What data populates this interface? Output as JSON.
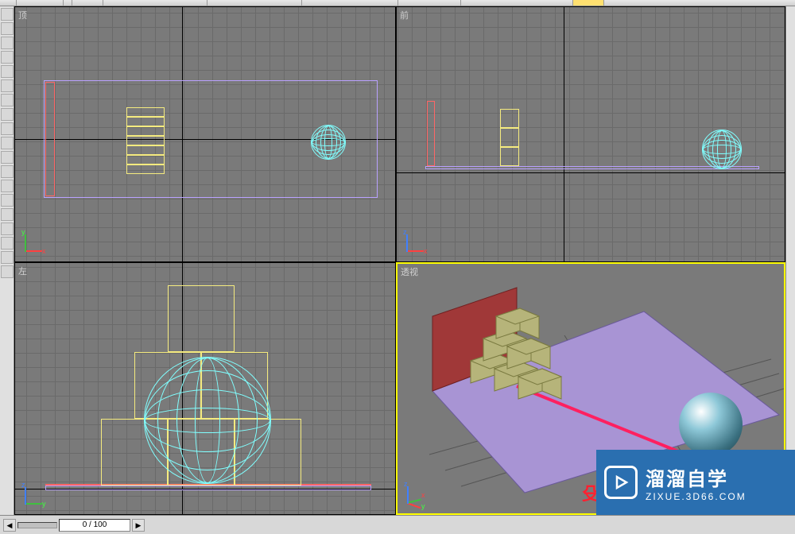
{
  "app": {
    "name": "3ds-max"
  },
  "viewports": {
    "top": {
      "label": "顶",
      "active": false
    },
    "front": {
      "label": "前",
      "active": false
    },
    "left": {
      "label": "左",
      "active": false
    },
    "persp": {
      "label": "透视",
      "active": true
    }
  },
  "axes": {
    "x": "x",
    "y": "y",
    "z": "z"
  },
  "timeline": {
    "frame_display": "0 / 100",
    "prev_icon": "◀",
    "next_icon": "▶"
  },
  "colors": {
    "wire_box": "#f5eb7f",
    "wire_ground": "#b9a1ff",
    "wire_wall": "#ff6666",
    "wire_sphere": "#80ffff",
    "floor": "#a894d4",
    "wall": "#a03838",
    "box": "#b0b070",
    "ray": "#ff2060",
    "active_border": "#ffff00"
  },
  "scene": {
    "boxes_stack_count": 6,
    "has_sphere": true,
    "has_floor": true,
    "has_wall": true,
    "has_trajectory_ray": true
  },
  "watermark": {
    "title": "溜溜自学",
    "url": "ZIXUE.3D66.COM",
    "partial_red_text": "殳"
  }
}
